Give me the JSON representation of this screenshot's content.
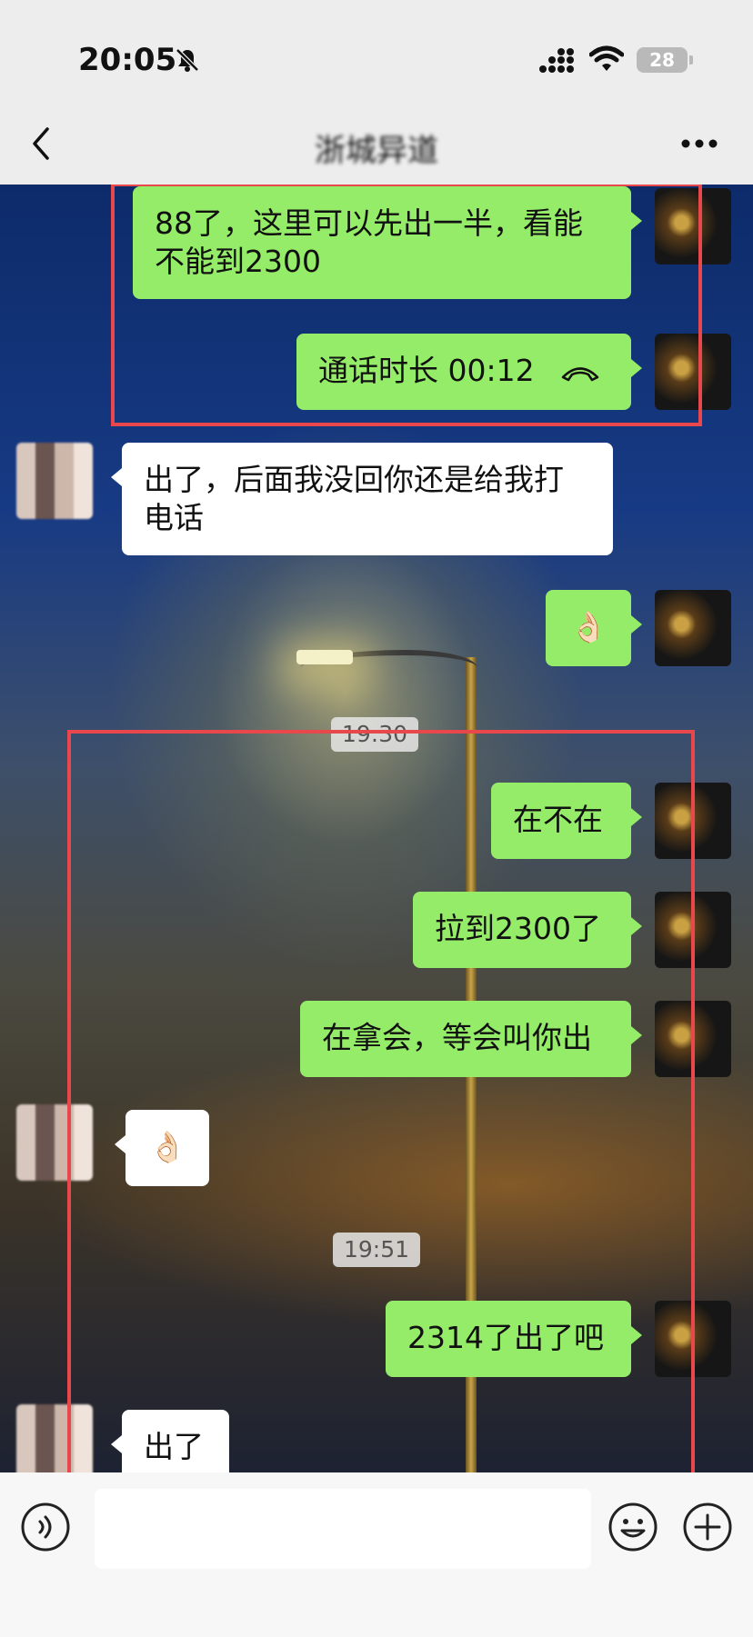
{
  "status_bar": {
    "time": "20:05",
    "battery": "28"
  },
  "nav": {
    "title": "浙城异道"
  },
  "messages": [
    {
      "text": "88了，这里可以先出一半，看能不能到2300",
      "from": "me"
    },
    {
      "text": "通话时长 00:12",
      "from": "me",
      "kind": "call"
    },
    {
      "text": "出了，后面我没回你还是给我打电话",
      "from": "other"
    },
    {
      "text": "👌🏻",
      "from": "me",
      "kind": "emoji"
    },
    {
      "text": "在不在",
      "from": "me"
    },
    {
      "text": "拉到2300了",
      "from": "me"
    },
    {
      "text": "在拿会，等会叫你出",
      "from": "me"
    },
    {
      "text": "👌🏻",
      "from": "other",
      "kind": "emoji"
    },
    {
      "text": "2314了出了吧",
      "from": "me"
    },
    {
      "text": "出了",
      "from": "other"
    }
  ],
  "timestamps": [
    "19:30",
    "19:51"
  ],
  "colors": {
    "my_bubble": "#95ec69",
    "their_bubble": "#ffffff",
    "highlight_box": "#e8474c"
  },
  "icons": [
    "muted-bell-icon",
    "signal-icon",
    "wifi-icon",
    "back-chevron-icon",
    "more-icon",
    "phone-hangup-icon",
    "voice-icon",
    "emoji-icon",
    "plus-icon"
  ]
}
